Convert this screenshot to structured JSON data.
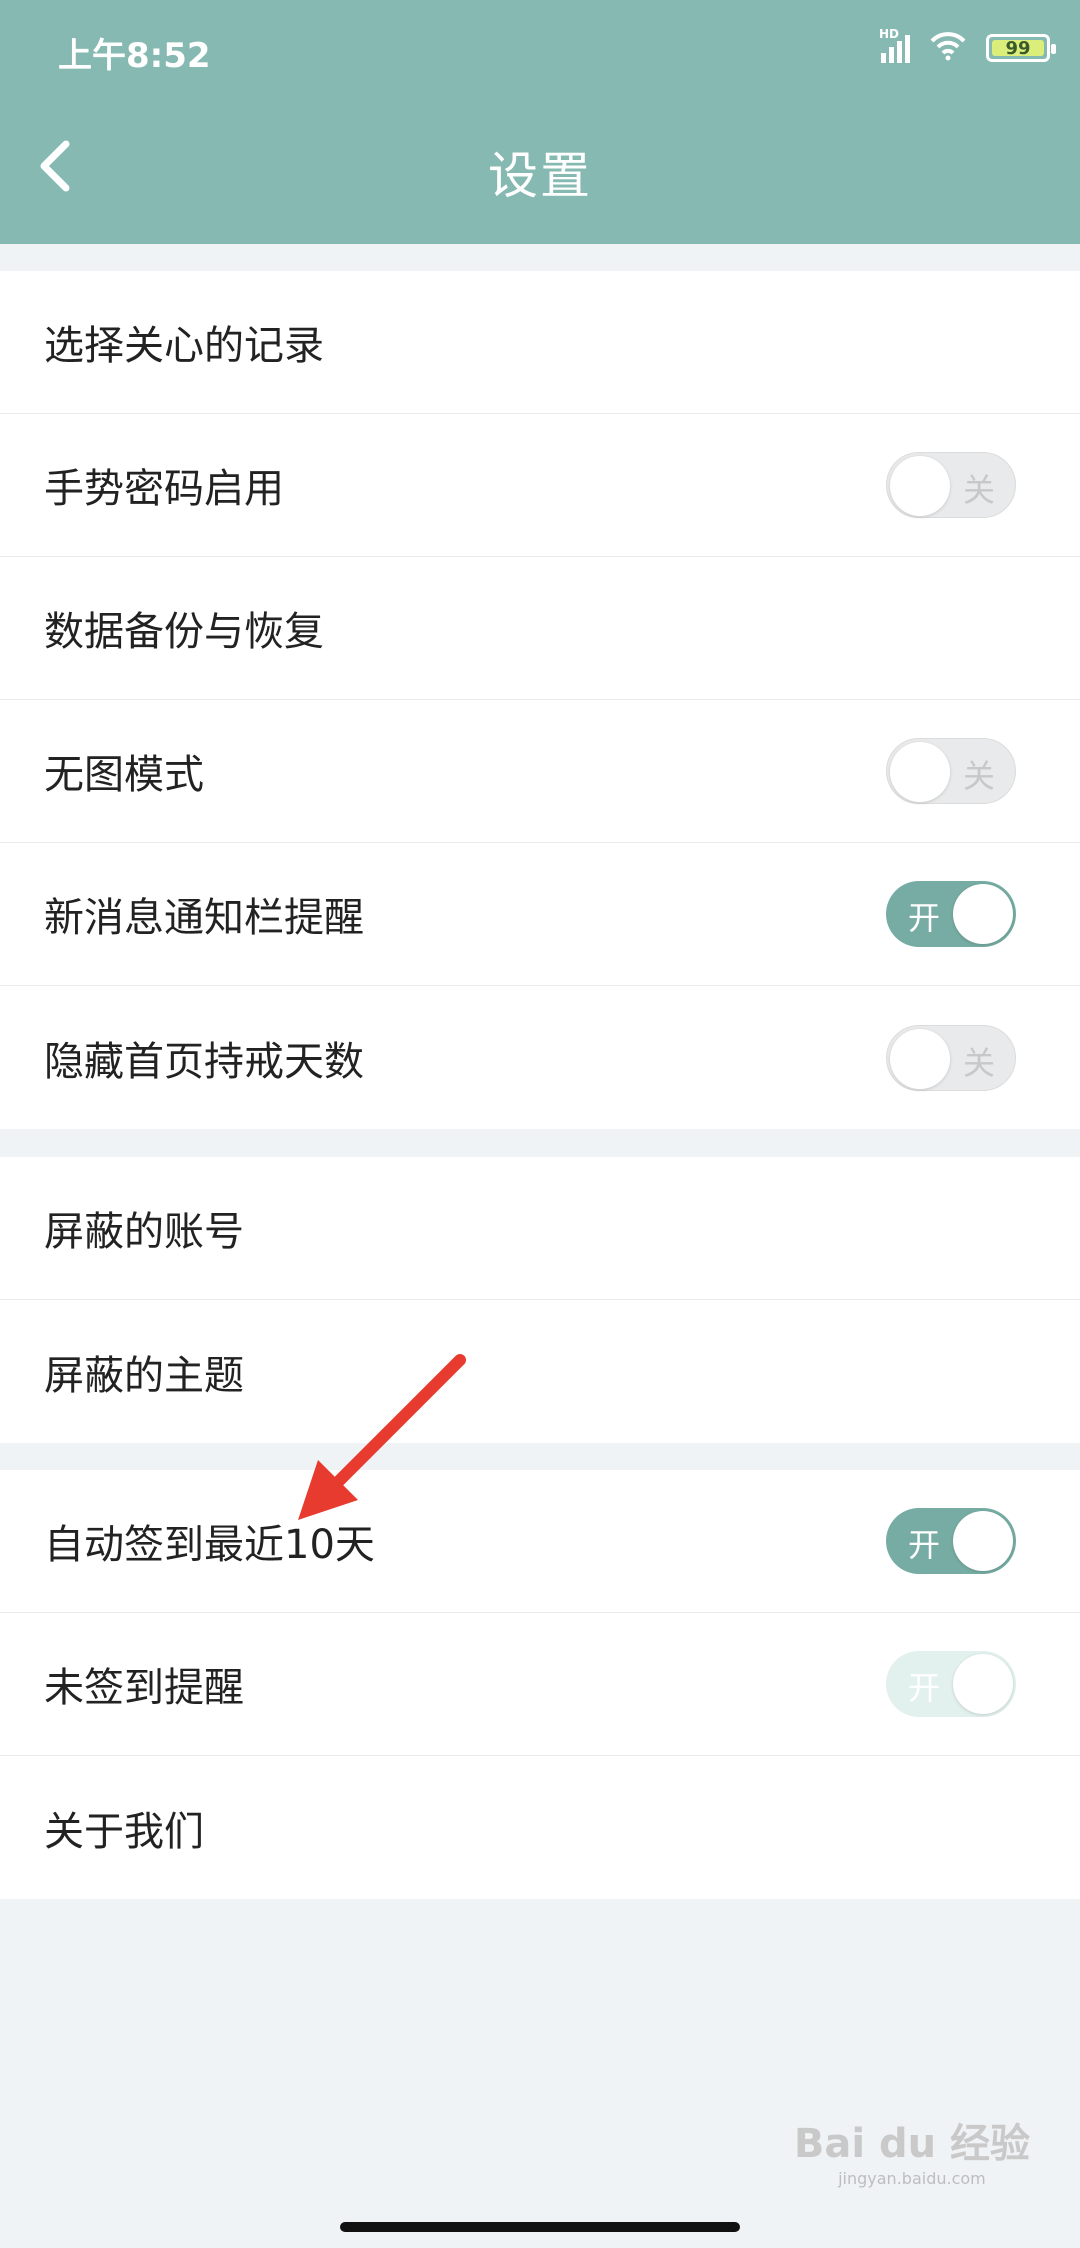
{
  "status": {
    "time": "上午8:52",
    "network": "HD",
    "battery": "99"
  },
  "header": {
    "title": "设置"
  },
  "groups": [
    {
      "items": [
        {
          "label": "选择关心的记录"
        },
        {
          "label": "手势密码启用",
          "toggle": {
            "state": "off",
            "text": "关"
          }
        },
        {
          "label": "数据备份与恢复"
        },
        {
          "label": "无图模式",
          "toggle": {
            "state": "off",
            "text": "关"
          }
        },
        {
          "label": "新消息通知栏提醒",
          "toggle": {
            "state": "on",
            "text": "开"
          }
        },
        {
          "label": "隐藏首页持戒天数",
          "toggle": {
            "state": "off",
            "text": "关"
          }
        }
      ]
    },
    {
      "items": [
        {
          "label": "屏蔽的账号"
        },
        {
          "label": "屏蔽的主题"
        }
      ]
    },
    {
      "items": [
        {
          "label": "自动签到最近10天",
          "toggle": {
            "state": "on",
            "text": "开"
          }
        },
        {
          "label": "未签到提醒",
          "toggle": {
            "state": "disabled",
            "text": "开"
          }
        },
        {
          "label": "关于我们"
        }
      ]
    }
  ],
  "watermark": {
    "text": "Bai du 经验",
    "sub": "jingyan.baidu.com"
  },
  "colors": {
    "header": "#86b9b1",
    "toggle_on": "#76aca3",
    "arrow": "#e63b2e"
  }
}
